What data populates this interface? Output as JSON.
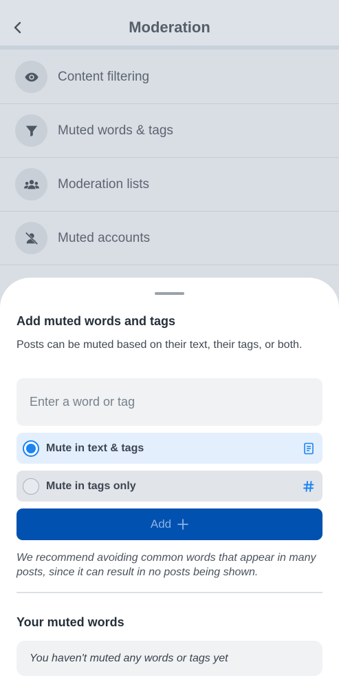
{
  "header": {
    "title": "Moderation",
    "back_icon": "chevron-left-icon"
  },
  "menu": {
    "items": [
      {
        "label": "Content filtering",
        "icon": "eye-icon"
      },
      {
        "label": "Muted words & tags",
        "icon": "filter-icon"
      },
      {
        "label": "Moderation lists",
        "icon": "group-icon"
      },
      {
        "label": "Muted accounts",
        "icon": "person-muted-icon"
      }
    ]
  },
  "sheet": {
    "title": "Add muted words and tags",
    "description": "Posts can be muted based on their text, their tags, or both.",
    "input_placeholder": "Enter a word or tag",
    "input_value": "",
    "options": [
      {
        "label": "Mute in text & tags",
        "selected": true,
        "icon": "document-icon"
      },
      {
        "label": "Mute in tags only",
        "selected": false,
        "icon": "hash-icon"
      }
    ],
    "add_button_label": "Add",
    "add_button_icon": "plus-icon",
    "recommendation": "We recommend avoiding common words that appear in many posts, since it can result in no posts being shown.",
    "muted_words_heading": "Your muted words",
    "empty_state": "You haven't muted any words or tags yet"
  },
  "colors": {
    "accent": "#1a84f3",
    "primary_button": "#0151b0",
    "background_dim": "#d9dee5"
  }
}
